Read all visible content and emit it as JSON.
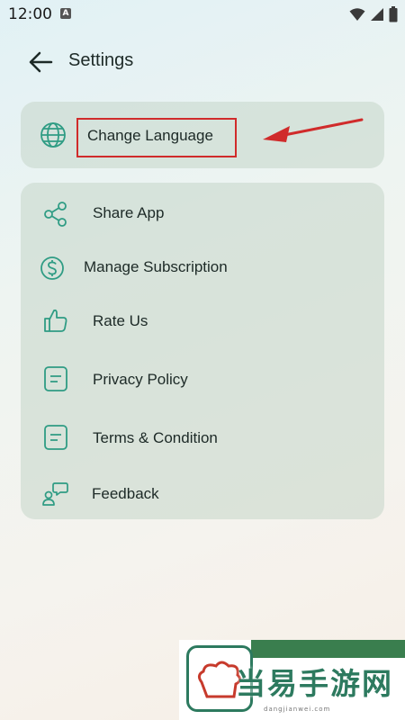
{
  "status_bar": {
    "time": "12:00",
    "notification_icon_letter": "A",
    "icons": [
      "wifi-icon",
      "cell-signal-icon",
      "battery-icon"
    ]
  },
  "header": {
    "title": "Settings",
    "back_icon": "arrow-left-icon"
  },
  "language_card": {
    "icon": "globe-icon",
    "label": "Change Language",
    "highlight_color": "#d02b2b"
  },
  "menu": {
    "items": [
      {
        "icon": "share-icon",
        "label": "Share App"
      },
      {
        "icon": "dollar-circle-icon",
        "label": "Manage Subscription"
      },
      {
        "icon": "thumbs-up-icon",
        "label": "Rate Us"
      },
      {
        "icon": "document-icon",
        "label": "Privacy Policy"
      },
      {
        "icon": "document-icon",
        "label": "Terms & Condition"
      },
      {
        "icon": "feedback-icon",
        "label": "Feedback"
      }
    ]
  },
  "watermark": {
    "text": "当易手游网",
    "url": "dangjianwei.com"
  },
  "colors": {
    "accent": "#2f9c84",
    "card_bg": "#c4d6c8",
    "annotation": "#d02b2b"
  }
}
